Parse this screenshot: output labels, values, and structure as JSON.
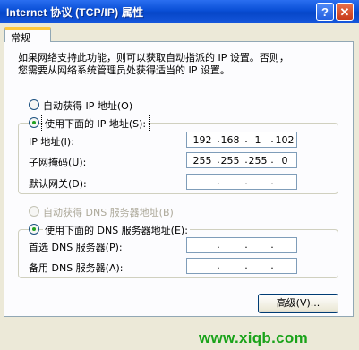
{
  "window": {
    "title": "Internet 协议 (TCP/IP) 属性",
    "help_label": "?",
    "close_label": "✕"
  },
  "tabs": [
    {
      "label": "常规"
    }
  ],
  "description": "如果网络支持此功能，则可以获取自动指派的 IP 设置。否则，\n您需要从网络系统管理员处获得适当的 IP 设置。",
  "ip_options": {
    "auto_label": "自动获得 IP 地址(O)",
    "manual_label": "使用下面的 IP 地址(S):",
    "selected": "manual"
  },
  "ip_fields": [
    {
      "label": "IP 地址(I):",
      "octets": [
        "192",
        "168",
        "1",
        "102"
      ]
    },
    {
      "label": "子网掩码(U):",
      "octets": [
        "255",
        "255",
        "255",
        "0"
      ]
    },
    {
      "label": "默认网关(D):",
      "octets": [
        "",
        "",
        "",
        ""
      ]
    }
  ],
  "dns_options": {
    "auto_label": "自动获得 DNS 服务器地址(B)",
    "manual_label": "使用下面的 DNS 服务器地址(E):",
    "selected": "manual",
    "auto_disabled": true
  },
  "dns_fields": [
    {
      "label": "首选 DNS 服务器(P):",
      "octets": [
        "",
        "",
        "",
        ""
      ]
    },
    {
      "label": "备用 DNS 服务器(A):",
      "octets": [
        "",
        "",
        "",
        ""
      ]
    }
  ],
  "advanced_button": "高级(V)...",
  "watermark": "www.xiqb.com",
  "colors": {
    "title_bar": "#0a4fd6",
    "dialog_bg": "#ece9d8",
    "radio_dot": "#21a121",
    "watermark": "#1aa31a"
  }
}
